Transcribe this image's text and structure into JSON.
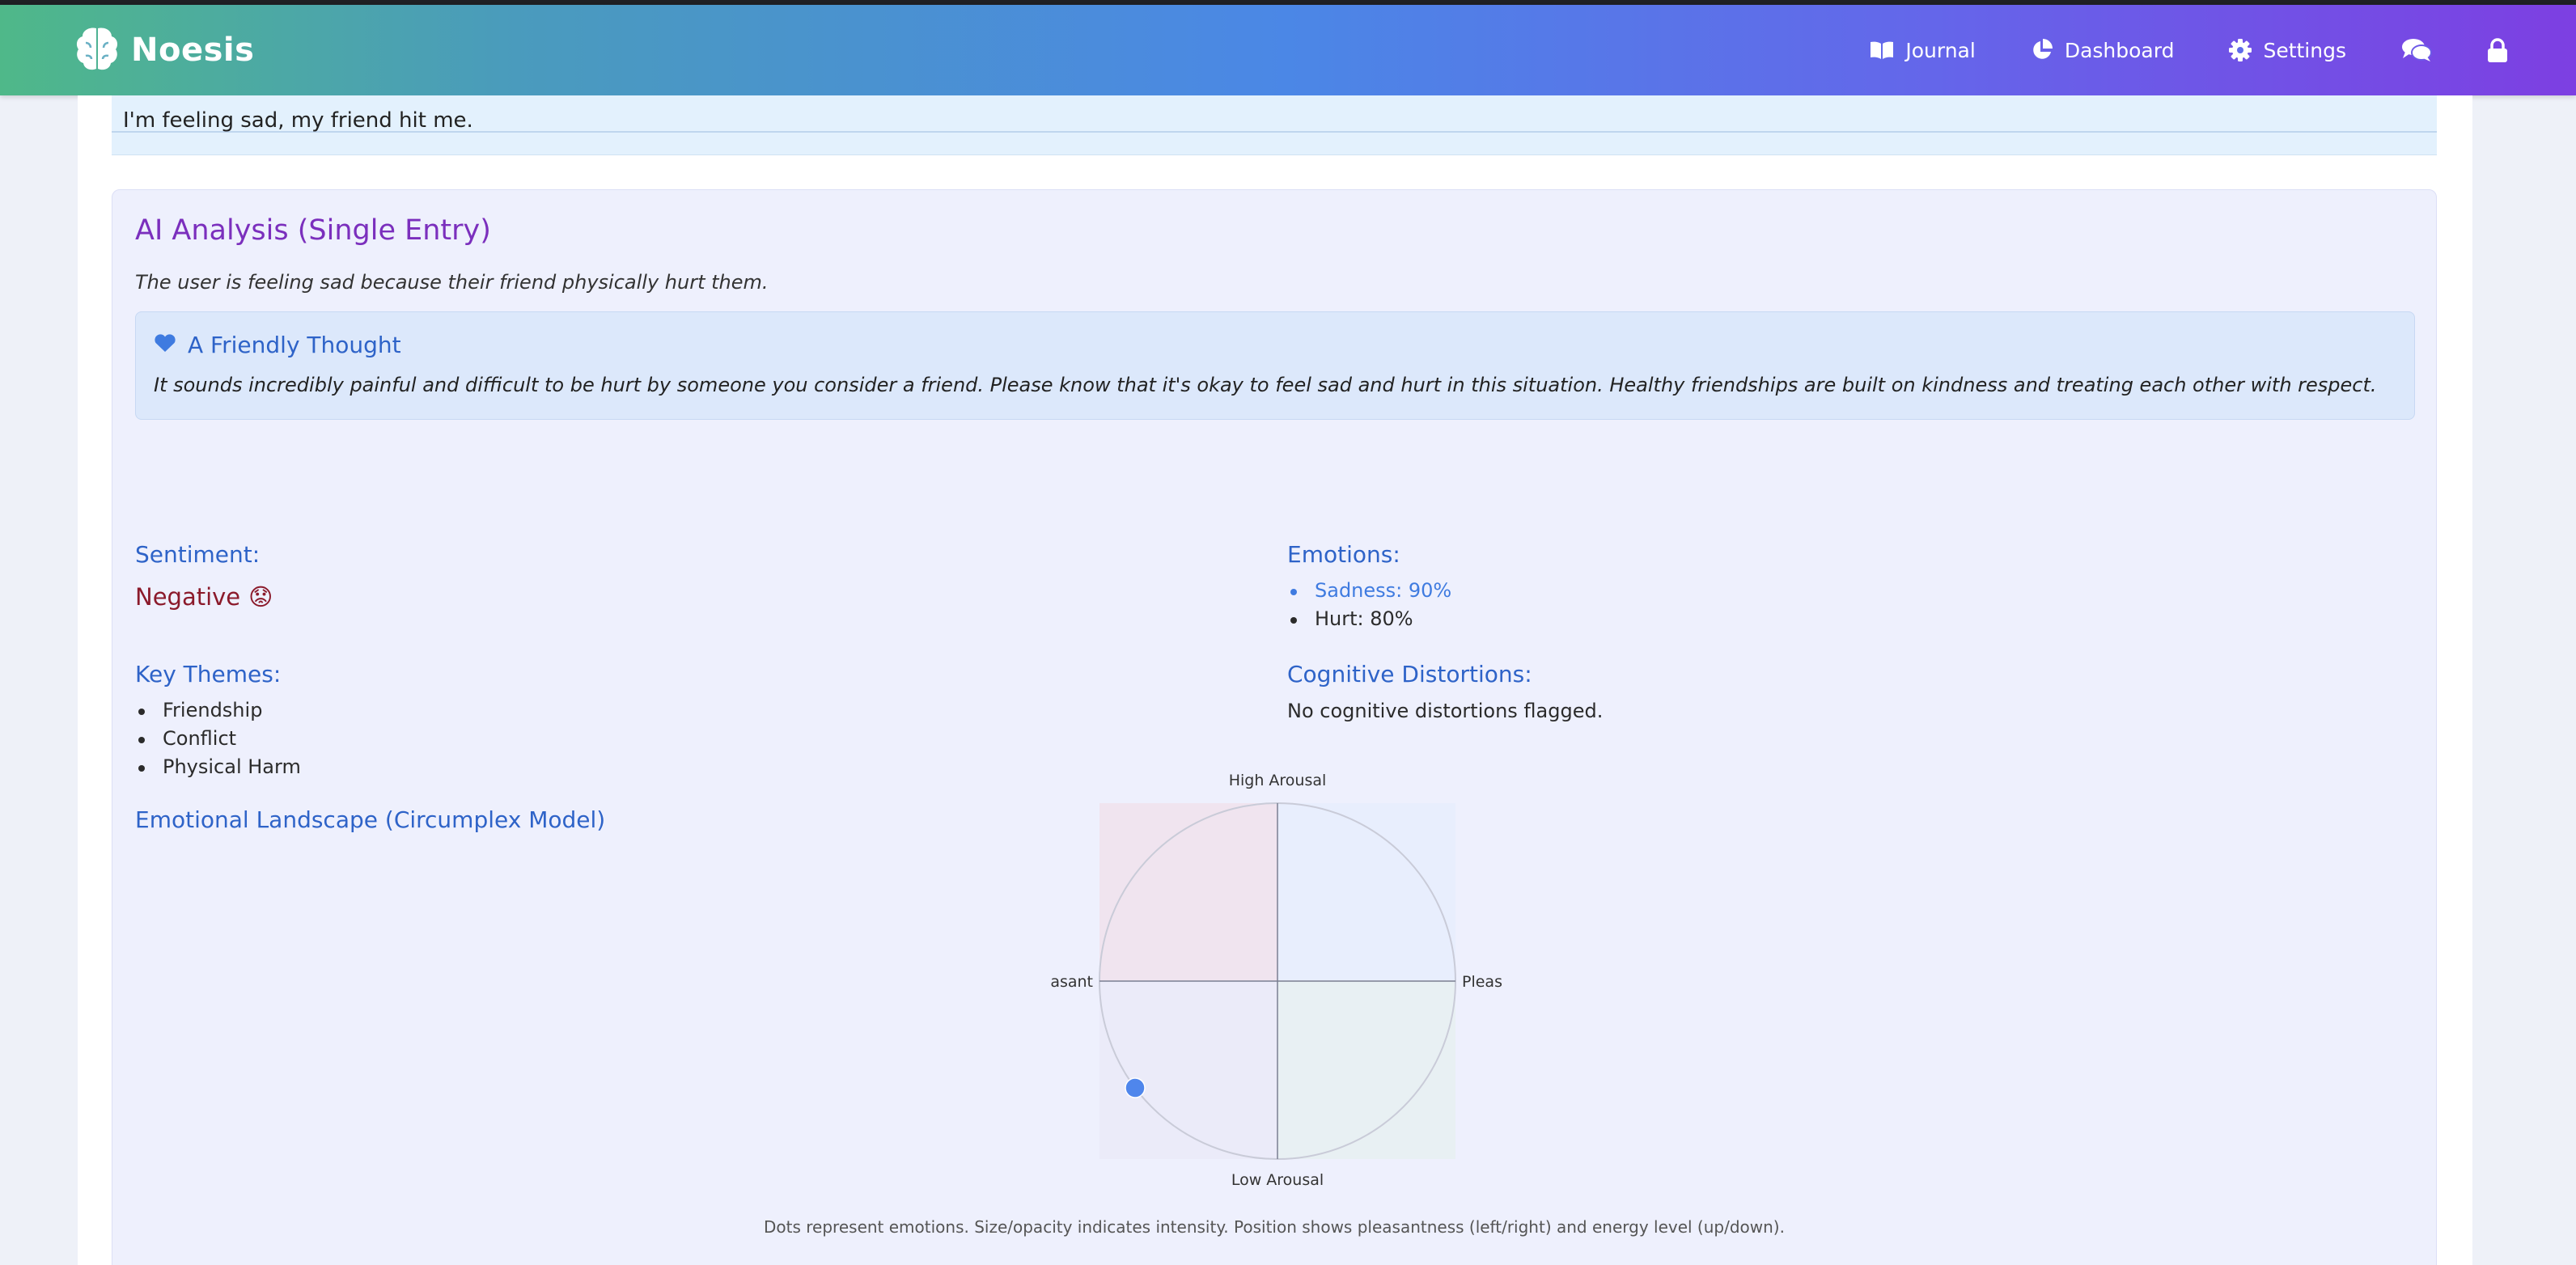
{
  "app": {
    "name": "Noesis"
  },
  "nav": {
    "journal": "Journal",
    "dashboard": "Dashboard",
    "settings": "Settings"
  },
  "entry": {
    "text": "I'm feeling sad, my friend hit me."
  },
  "analysis": {
    "title": "AI Analysis (Single Entry)",
    "summary": "The user is feeling sad because their friend physically hurt them.",
    "thought_title": "A Friendly Thought",
    "thought_text": "It sounds incredibly painful and difficult to be hurt by someone you consider a friend. Please know that it's okay to feel sad and hurt in this situation. Healthy friendships are built on kindness and treating each other with respect.",
    "sentiment_label": "Sentiment:",
    "sentiment_value": "Negative",
    "sentiment_emoji": "😟",
    "emotions_label": "Emotions:",
    "emotions": [
      "Sadness: 90%",
      "Hurt: 80%"
    ],
    "themes_label": "Key Themes:",
    "themes": [
      "Friendship",
      "Conflict",
      "Physical Harm"
    ],
    "distortions_label": "Cognitive Distortions:",
    "distortions_text": "No cognitive distortions flagged.",
    "landscape_title": "Emotional Landscape (Circumplex Model)",
    "caption": "Dots represent emotions. Size/opacity indicates intensity. Position shows pleasantness (left/right) and energy level (up/down)."
  },
  "chart_data": {
    "type": "scatter",
    "axis_labels": {
      "top": "High Arousal",
      "bottom": "Low Arousal",
      "left": "asant",
      "right": "Pleas"
    },
    "xlim": [
      -1,
      1
    ],
    "ylim": [
      -1,
      1
    ],
    "points": [
      {
        "x": -0.8,
        "y": -0.6
      }
    ],
    "colors": {
      "point": "#4f86ec",
      "q_top_left": "#f0e4ef",
      "q_top_right": "#e8eefd",
      "q_bottom_left": "#ebebf9",
      "q_bottom_right": "#e8f0f3"
    }
  }
}
